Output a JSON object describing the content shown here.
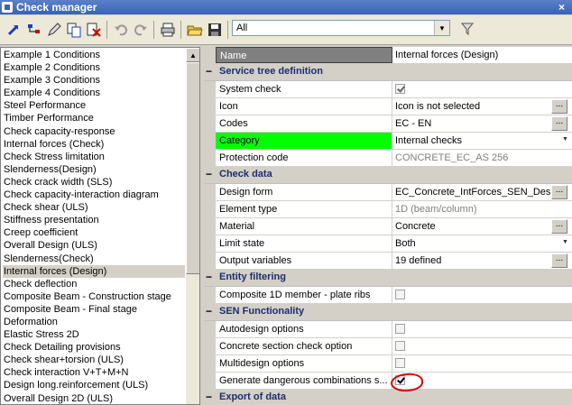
{
  "window": {
    "title": "Check manager",
    "close_label": "×"
  },
  "toolbar": {
    "icons": [
      "blue-arrow-icon",
      "tree-icon",
      "pencil-icon",
      "copy-icon",
      "delete-icon",
      "undo-icon",
      "redo-icon",
      "print-icon",
      "open-folder-icon",
      "save-icon",
      "filter-icon"
    ],
    "filter_value": "All"
  },
  "left_list": {
    "items": [
      "Example 1 Conditions",
      "Example 2 Conditions",
      "Example 3 Conditions",
      "Example 4 Conditions",
      "Steel Performance",
      "Timber Performance",
      "Check capacity-response",
      "Internal forces (Check)",
      "Check Stress limitation",
      "Slenderness(Design)",
      "Check crack width (SLS)",
      "Check capacity-interaction diagram",
      "Check shear (ULS)",
      "Stiffness presentation",
      "Creep coefficient",
      "Overall Design (ULS)",
      "Slenderness(Check)",
      "Internal forces (Design)",
      "Check deflection",
      "Composite Beam - Construction stage",
      "Composite Beam - Final stage",
      "Deformation",
      "Elastic Stress 2D",
      "Check Detailing provisions",
      "Check shear+torsion (ULS)",
      "Check interaction V+T+M+N",
      "Design long.reinforcement (ULS)",
      "Overall Design 2D (ULS)"
    ],
    "selected": "Internal forces (Design)"
  },
  "properties": {
    "name": {
      "label": "Name",
      "value": "Internal forces (Design)"
    },
    "sections": [
      {
        "title": "Service tree definition",
        "rows": [
          {
            "label": "System check",
            "type": "checkbox",
            "checked": true
          },
          {
            "label": "Icon",
            "value": "Icon is not selected",
            "button": "..."
          },
          {
            "label": "Codes",
            "value": "EC - EN",
            "button": "..."
          },
          {
            "label": "Category",
            "value": "Internal checks",
            "dropdown": true,
            "highlight": "#00ff00"
          },
          {
            "label": "Protection code",
            "value": "CONCRETE_EC_AS 256",
            "grey": true
          }
        ]
      },
      {
        "title": "Check data",
        "rows": [
          {
            "label": "Design form",
            "value": "EC_Concrete_IntForces_SEN_Desig...",
            "button": "..."
          },
          {
            "label": "Element type",
            "value": "1D (beam/column)",
            "grey": true
          },
          {
            "label": "Material",
            "value": "Concrete",
            "button": "..."
          },
          {
            "label": "Limit state",
            "value": "Both",
            "dropdown": true
          },
          {
            "label": "Output variables",
            "value": "19 defined",
            "button": "..."
          }
        ]
      },
      {
        "title": "Entity filtering",
        "rows": [
          {
            "label": "Composite 1D member - plate ribs",
            "type": "checkbox",
            "checked": false
          }
        ]
      },
      {
        "title": "SEN Functionality",
        "rows": [
          {
            "label": "Autodesign options",
            "type": "checkbox",
            "checked": false
          },
          {
            "label": "Concrete section check option",
            "type": "checkbox",
            "checked": false
          },
          {
            "label": "Multidesign options",
            "type": "checkbox",
            "checked": false
          },
          {
            "label": "Generate dangerous combinations s...",
            "type": "checkbox",
            "checked": true
          }
        ]
      },
      {
        "title": "Export of data",
        "rows": []
      }
    ],
    "section_toggle": "−"
  }
}
